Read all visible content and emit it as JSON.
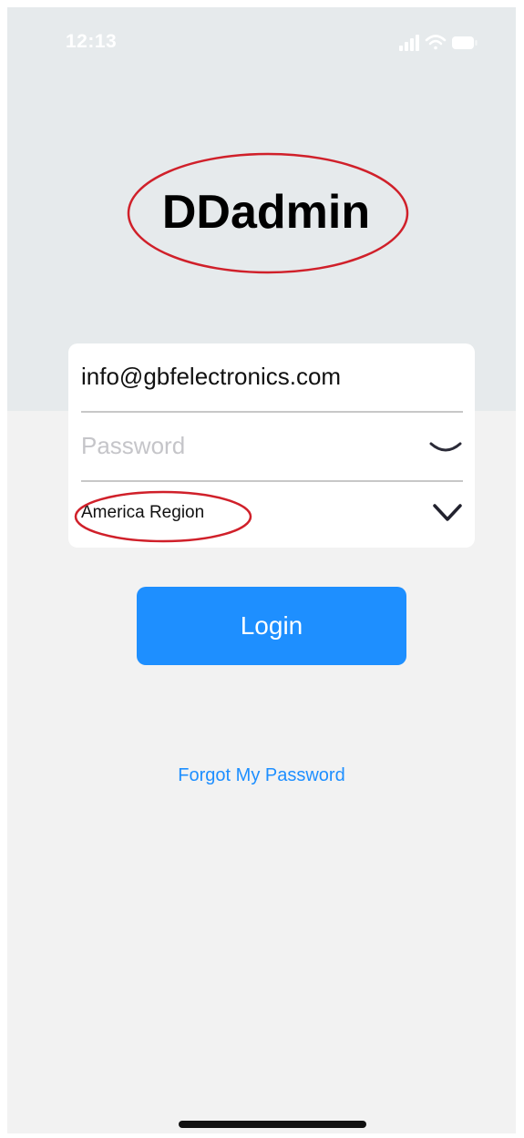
{
  "status_bar": {
    "time": "12:13",
    "icons": [
      "signal-icon",
      "wifi-icon",
      "battery-icon"
    ]
  },
  "header": {
    "title": "DDadmin",
    "annotation_color": "#d0202a"
  },
  "login_form": {
    "email_value": "info@gbfelectronics.com",
    "password_placeholder": "Password",
    "password_icon": "eye-closed-icon",
    "region_value": "America Region",
    "region_icon": "chevron-down-icon"
  },
  "login_button": {
    "label": "Login"
  },
  "forgot_password": {
    "label": "Forgot My Password"
  },
  "colors": {
    "accent": "#1e8fff",
    "header_background": "#e6eaec",
    "page_background": "#f2f2f2"
  }
}
